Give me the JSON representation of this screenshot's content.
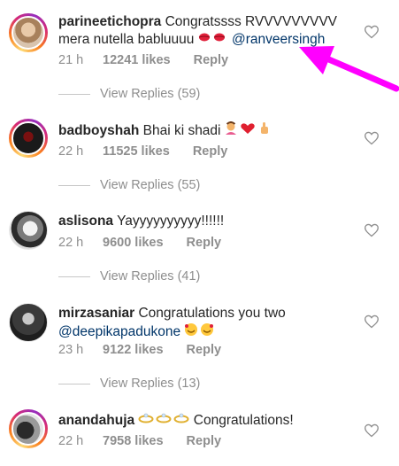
{
  "comments": [
    {
      "username": "parineetichopra",
      "text_line1": "Congratssss RVVVVVVVVV",
      "text_line2": "mera nutella babluuuu",
      "mention": "@ranveersingh",
      "time": "21 h",
      "likes": "12241 likes",
      "reply": "Reply",
      "view_replies": "View Replies (59)"
    },
    {
      "username": "badboyshah",
      "text": "Bhai ki shadi",
      "time": "22 h",
      "likes": "11525 likes",
      "reply": "Reply",
      "view_replies": "View Replies (55)"
    },
    {
      "username": "aslisona",
      "text": "Yayyyyyyyyyy!!!!!!",
      "time": "22 h",
      "likes": "9600 likes",
      "reply": "Reply",
      "view_replies": "View Replies (41)"
    },
    {
      "username": "mirzasaniar",
      "text": "Congratulations you two",
      "mention": "@deepikapadukone",
      "time": "23 h",
      "likes": "9122 likes",
      "reply": "Reply",
      "view_replies": "View Replies (13)"
    },
    {
      "username": "anandahuja",
      "text": "Congratulations!",
      "time": "22 h",
      "likes": "7958 likes",
      "reply": "Reply"
    }
  ],
  "colors": {
    "mention": "#003569",
    "meta": "#8e8e8e",
    "arrow": "#ff00ff"
  },
  "icons": [
    "heart-outline-icon",
    "kiss-mark-emoji",
    "person-gesturing-emoji",
    "red-heart-emoji",
    "thumbs-up-emoji",
    "smiling-face-with-hearts-emoji",
    "ring-emoji"
  ]
}
